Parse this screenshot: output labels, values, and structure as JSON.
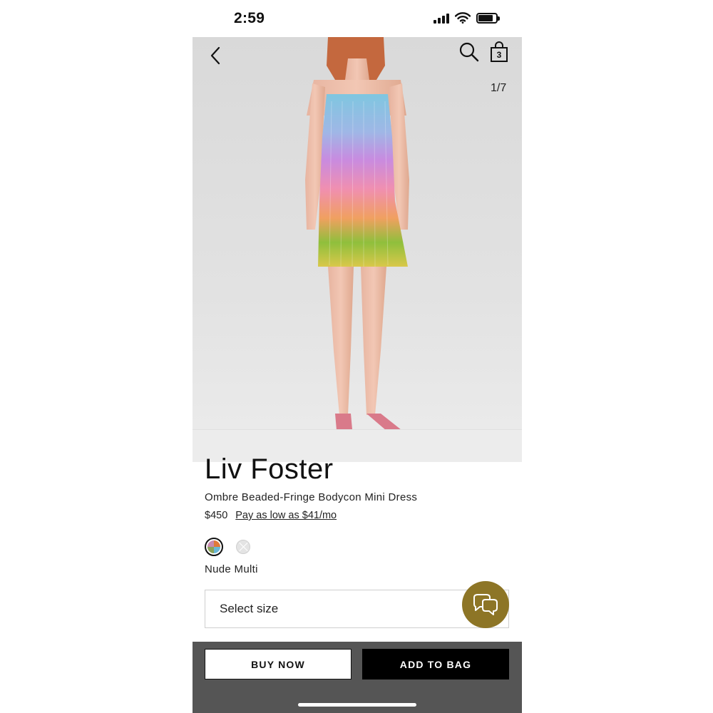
{
  "status_bar": {
    "time": "2:59"
  },
  "nav": {
    "bag_count": "3",
    "image_counter": "1/7"
  },
  "product": {
    "brand": "Liv Foster",
    "name": "Ombre Beaded-Fringe Bodycon Mini Dress",
    "price": "$450",
    "pay_link": "Pay as low as $41/mo",
    "color_name": "Nude Multi",
    "swatches": [
      {
        "name": "Nude Multi",
        "selected": true
      },
      {
        "name": "Silver",
        "selected": false
      }
    ]
  },
  "size_select": {
    "placeholder": "Select size"
  },
  "actions": {
    "buy_now": "BUY NOW",
    "add_to_bag": "ADD TO BAG"
  },
  "colors": {
    "chat_fab": "#8d7526",
    "action_bar": "#555555",
    "primary_button": "#000000"
  },
  "icons": [
    "back-arrow-icon",
    "search-icon",
    "shopping-bag-icon",
    "chat-bubbles-icon",
    "signal-icon",
    "wifi-icon",
    "battery-icon"
  ]
}
